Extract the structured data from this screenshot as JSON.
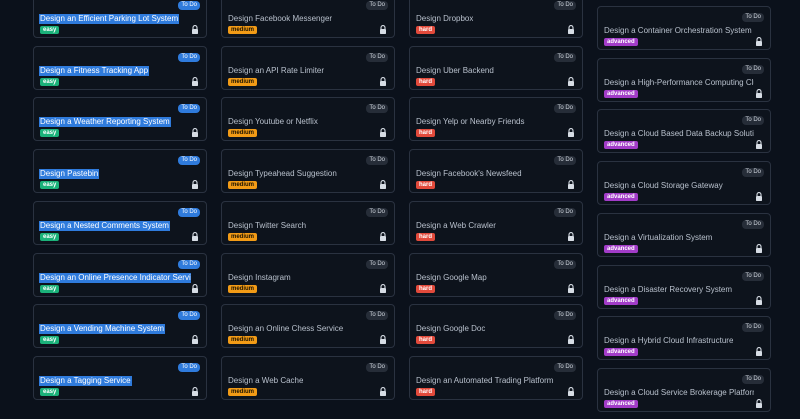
{
  "columns": [
    {
      "cards": [
        {
          "title": "Design an Efficient Parking Lot System",
          "status": "To Do",
          "difficulty": "easy",
          "selected": true
        },
        {
          "title": "Design a Fitness Tracking App",
          "status": "To Do",
          "difficulty": "easy",
          "selected": true
        },
        {
          "title": "Design a Weather Reporting System",
          "status": "To Do",
          "difficulty": "easy",
          "selected": true
        },
        {
          "title": "Design Pastebin",
          "status": "To Do",
          "difficulty": "easy",
          "selected": true
        },
        {
          "title": "Design a Nested Comments System",
          "status": "To Do",
          "difficulty": "easy",
          "selected": true
        },
        {
          "title": "Design an Online Presence Indicator Service",
          "status": "To Do",
          "difficulty": "easy",
          "selected": true
        },
        {
          "title": "Design a Vending Machine System",
          "status": "To Do",
          "difficulty": "easy",
          "selected": true
        },
        {
          "title": "Design a Tagging Service",
          "status": "To Do",
          "difficulty": "easy",
          "selected": true
        }
      ]
    },
    {
      "cards": [
        {
          "title": "Design Facebook Messenger",
          "status": "To Do",
          "difficulty": "medium"
        },
        {
          "title": "Design an API Rate Limiter",
          "status": "To Do",
          "difficulty": "medium"
        },
        {
          "title": "Design Youtube or Netflix",
          "status": "To Do",
          "difficulty": "medium"
        },
        {
          "title": "Design Typeahead Suggestion",
          "status": "To Do",
          "difficulty": "medium"
        },
        {
          "title": "Design Twitter Search",
          "status": "To Do",
          "difficulty": "medium"
        },
        {
          "title": "Design Instagram",
          "status": "To Do",
          "difficulty": "medium"
        },
        {
          "title": "Design an Online Chess Service",
          "status": "To Do",
          "difficulty": "medium"
        },
        {
          "title": "Design a Web Cache",
          "status": "To Do",
          "difficulty": "medium"
        }
      ]
    },
    {
      "cards": [
        {
          "title": "Design Dropbox",
          "status": "To Do",
          "difficulty": "hard"
        },
        {
          "title": "Design Uber Backend",
          "status": "To Do",
          "difficulty": "hard"
        },
        {
          "title": "Design Yelp or Nearby Friends",
          "status": "To Do",
          "difficulty": "hard"
        },
        {
          "title": "Design Facebook's Newsfeed",
          "status": "To Do",
          "difficulty": "hard"
        },
        {
          "title": "Design a Web Crawler",
          "status": "To Do",
          "difficulty": "hard"
        },
        {
          "title": "Design Google Map",
          "status": "To Do",
          "difficulty": "hard"
        },
        {
          "title": "Design Google Doc",
          "status": "To Do",
          "difficulty": "hard"
        },
        {
          "title": "Design an Automated Trading Platform",
          "status": "To Do",
          "difficulty": "hard"
        }
      ]
    },
    {
      "cards": [
        {
          "title": "Design a Container Orchestration System",
          "status": "To Do",
          "difficulty": "advanced"
        },
        {
          "title": "Design a High-Performance Computing Cluster",
          "status": "To Do",
          "difficulty": "advanced"
        },
        {
          "title": "Design a Cloud Based Data Backup Solution",
          "status": "To Do",
          "difficulty": "advanced"
        },
        {
          "title": "Design a Cloud Storage Gateway",
          "status": "To Do",
          "difficulty": "advanced"
        },
        {
          "title": "Design a Virtualization System",
          "status": "To Do",
          "difficulty": "advanced"
        },
        {
          "title": "Design a Disaster Recovery System",
          "status": "To Do",
          "difficulty": "advanced"
        },
        {
          "title": "Design a Hybrid Cloud Infrastructure",
          "status": "To Do",
          "difficulty": "advanced"
        },
        {
          "title": "Design a Cloud Service Brokerage Platform",
          "status": "To Do",
          "difficulty": "advanced"
        }
      ]
    }
  ],
  "icons": {
    "lock": "lock-icon"
  },
  "colors": {
    "easy": "#1bb27a",
    "medium": "#f29b16",
    "hard": "#e24a3b",
    "advanced": "#a23cc8",
    "selection": "#2f7bdc"
  }
}
